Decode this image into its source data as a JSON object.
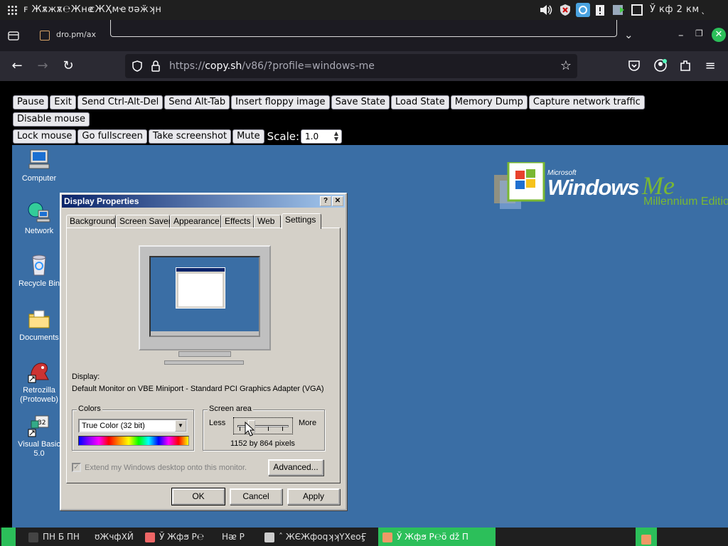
{
  "os_topbar": {
    "left_items": [
      "ꜰ Жѫжѫ℮Жне",
      "сЖҲмҽ",
      "ʊǝӝʞн"
    ],
    "clock": "Ў кф 2 км"
  },
  "browser": {
    "tab_title": "dro.pm/ax",
    "url_prefix": "https://",
    "url_host": "copy.sh",
    "url_path": "/v86/?profile=windows-me",
    "colors": {
      "chrome_bg": "#1c1b22",
      "toolbar_bg": "#2b2a33",
      "close_green": "#2cbf5a"
    }
  },
  "emulator": {
    "buttons": [
      "Pause",
      "Exit",
      "Send Ctrl-Alt-Del",
      "Send Alt-Tab",
      "Insert floppy image",
      "Save State",
      "Load State",
      "Memory Dump",
      "Capture network traffic",
      "Disable mouse",
      "Lock mouse",
      "Go fullscreen",
      "Take screenshot",
      "Mute"
    ],
    "scale_label": "Scale:",
    "scale_value": "1.0"
  },
  "desktop": {
    "background": "#3a6ea5",
    "icons": [
      {
        "label": "Computer",
        "icon": "computer-icon"
      },
      {
        "label": "Network",
        "icon": "network-icon"
      },
      {
        "label": "Recycle Bin",
        "icon": "recycle-bin-icon"
      },
      {
        "label": "Documents",
        "icon": "documents-folder-icon"
      },
      {
        "label": "Retrozilla (Protoweb)",
        "icon": "retrozilla-icon"
      },
      {
        "label": "Visual Basic 5.0",
        "icon": "visual-basic-icon"
      }
    ],
    "logo": {
      "microsoft": "Microsoft",
      "windows": "Windows",
      "me": "Me",
      "edition": "Millennium Edition"
    }
  },
  "dialog": {
    "title": "Display Properties",
    "help_btn": "?",
    "close_btn": "✕",
    "tabs": [
      "Background",
      "Screen Saver",
      "Appearance",
      "Effects",
      "Web",
      "Settings"
    ],
    "active_tab": "Settings",
    "display_label": "Display:",
    "display_value": "Default Monitor on VBE Miniport - Standard PCI Graphics Adapter (VGA)",
    "colors_group": "Colors",
    "colors_value": "True Color (32 bit)",
    "screen_area_group": "Screen area",
    "less": "Less",
    "more": "More",
    "resolution": "1152 by 864 pixels",
    "screen_area_level": 0.25,
    "extend_label": "Extend my Windows desktop onto this monitor.",
    "advanced_btn": "Advanced...",
    "ok_btn": "OK",
    "cancel_btn": "Cancel",
    "apply_btn": "Apply"
  },
  "taskbar": {
    "items": [
      "ПН  Б ПН",
      "ʊЖчфХЙ",
      "Ў Жфϧ Р℮",
      "Нᴂ Р",
      "ˆ ЖЄЖфоqʞʞҮХеоӺ",
      "Ў Жфϧ Р℮ӧ dž П"
    ]
  }
}
